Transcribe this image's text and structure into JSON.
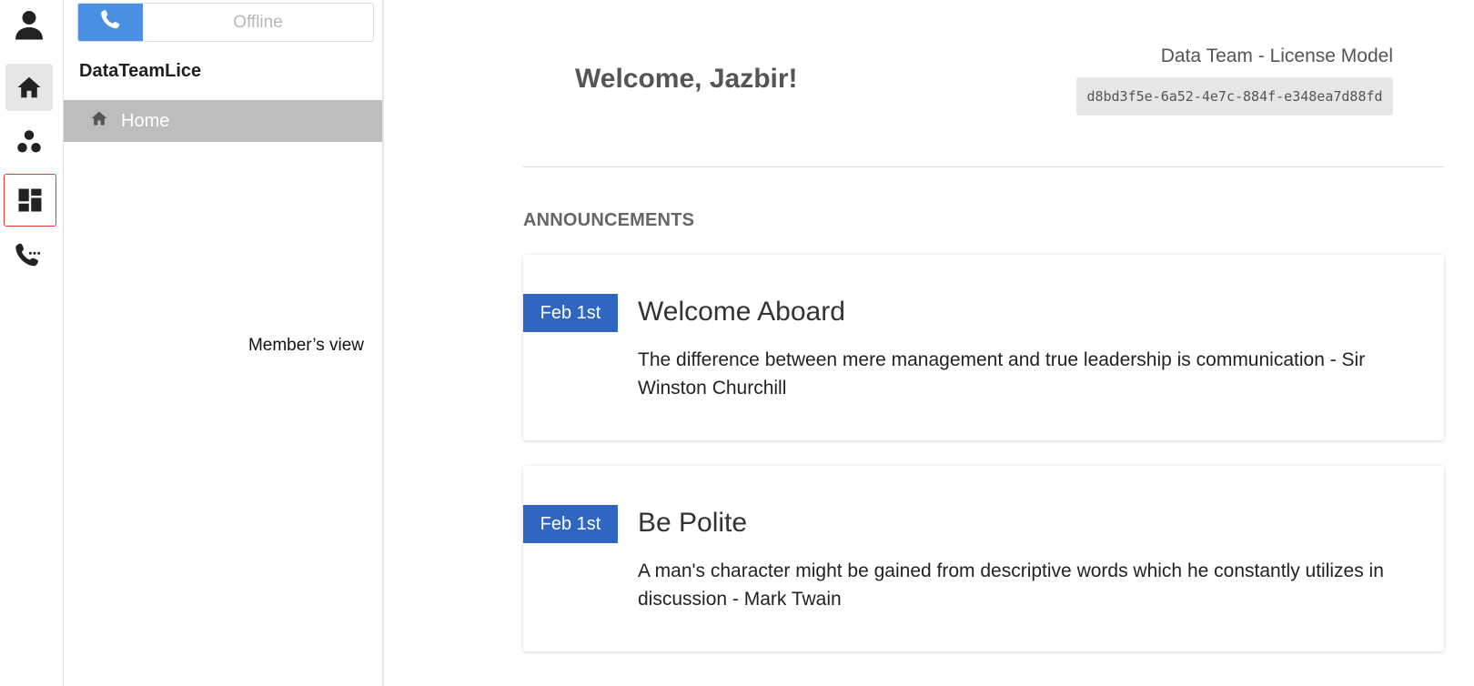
{
  "rail": {
    "items": [
      {
        "icon": "user-icon"
      },
      {
        "icon": "home-icon"
      },
      {
        "icon": "teams-icon"
      },
      {
        "icon": "dashboard-icon"
      },
      {
        "icon": "call-log-icon"
      }
    ]
  },
  "sidebar": {
    "status": "Offline",
    "org_name": "DataTeamLice",
    "nav": [
      {
        "label": "Home",
        "icon": "home-icon"
      }
    ],
    "annotation": "Member’s view"
  },
  "main": {
    "welcome": "Welcome, Jazbir!",
    "team_name": "Data Team - License Model",
    "team_id": "d8bd3f5e-6a52-4e7c-884f-e348ea7d88fd",
    "announcements_heading": "ANNOUNCEMENTS",
    "announcements": [
      {
        "date": "Feb 1st",
        "title": "Welcome Aboard",
        "body": "The difference between mere management and true leadership is communication - Sir Winston Churchill"
      },
      {
        "date": "Feb 1st",
        "title": "Be Polite",
        "body": "A man's character might be gained from descriptive words which he constantly utilizes in discussion - Mark Twain"
      }
    ]
  },
  "colors": {
    "accent_blue": "#2f66c1",
    "phone_blue": "#4a90e2",
    "nav_active": "#bdbdbd",
    "highlight_red": "#e53935"
  }
}
